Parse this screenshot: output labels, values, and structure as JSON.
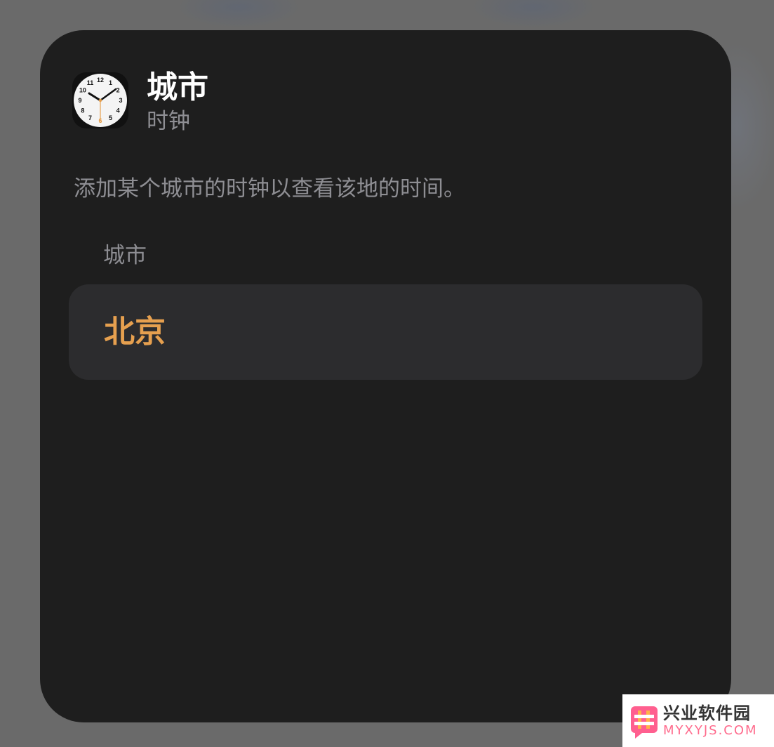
{
  "widget": {
    "app_icon": "clock-icon",
    "title": "城市",
    "subtitle": "时钟",
    "description": "添加某个城市的时钟以查看该地的时间。",
    "section_label": "城市",
    "city": {
      "name": "北京"
    }
  },
  "watermark": {
    "logo_icon": "hash-logo-icon",
    "name": "兴业软件园",
    "domain": "MYXYJS.COM"
  },
  "colors": {
    "widget_background": "#1e1e1e",
    "row_background": "#2c2c2e",
    "accent": "#e6a04f",
    "secondary_text": "#8e8e93",
    "primary_text": "#ffffff"
  },
  "clock_face": {
    "numbers": [
      "12",
      "1",
      "2",
      "3",
      "4",
      "5",
      "6",
      "7",
      "8",
      "9",
      "10",
      "11"
    ]
  }
}
